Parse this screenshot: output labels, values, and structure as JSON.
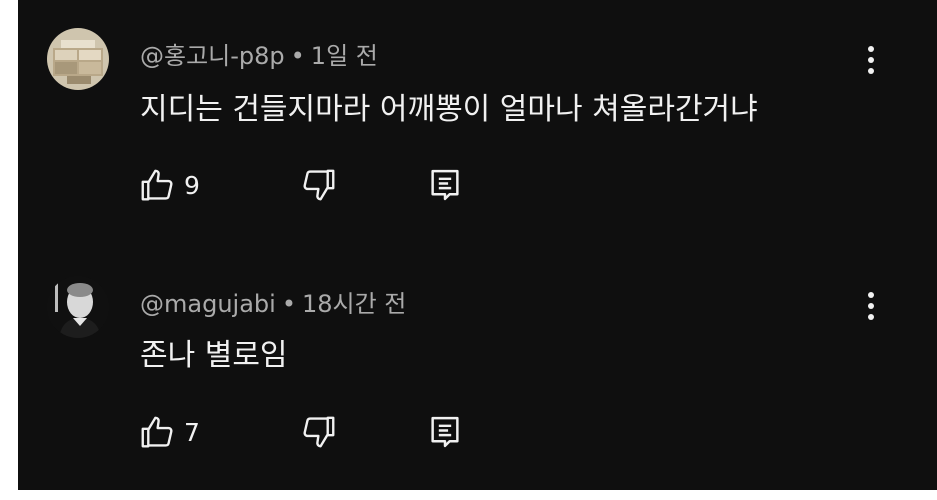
{
  "comments": [
    {
      "author": "@홍고니-p8p",
      "separator": "•",
      "time": "1일 전",
      "text": "지디는 건들지마라 어깨뽕이 얼마나 쳐올라간거냐",
      "likes": "9",
      "avatar_icon": "avatar-cash-photo"
    },
    {
      "author": "@magujabi",
      "separator": "•",
      "time": "18시간 전",
      "text": "존나 별로임",
      "likes": "7",
      "avatar_icon": "avatar-bw-portrait"
    }
  ],
  "icons": {
    "like": "thumbs-up-icon",
    "dislike": "thumbs-down-icon",
    "reply": "reply-icon",
    "menu": "more-vert-icon"
  },
  "colors": {
    "background": "#0f0f0f",
    "text": "#f1f1f1",
    "meta": "#aaaaaa"
  }
}
